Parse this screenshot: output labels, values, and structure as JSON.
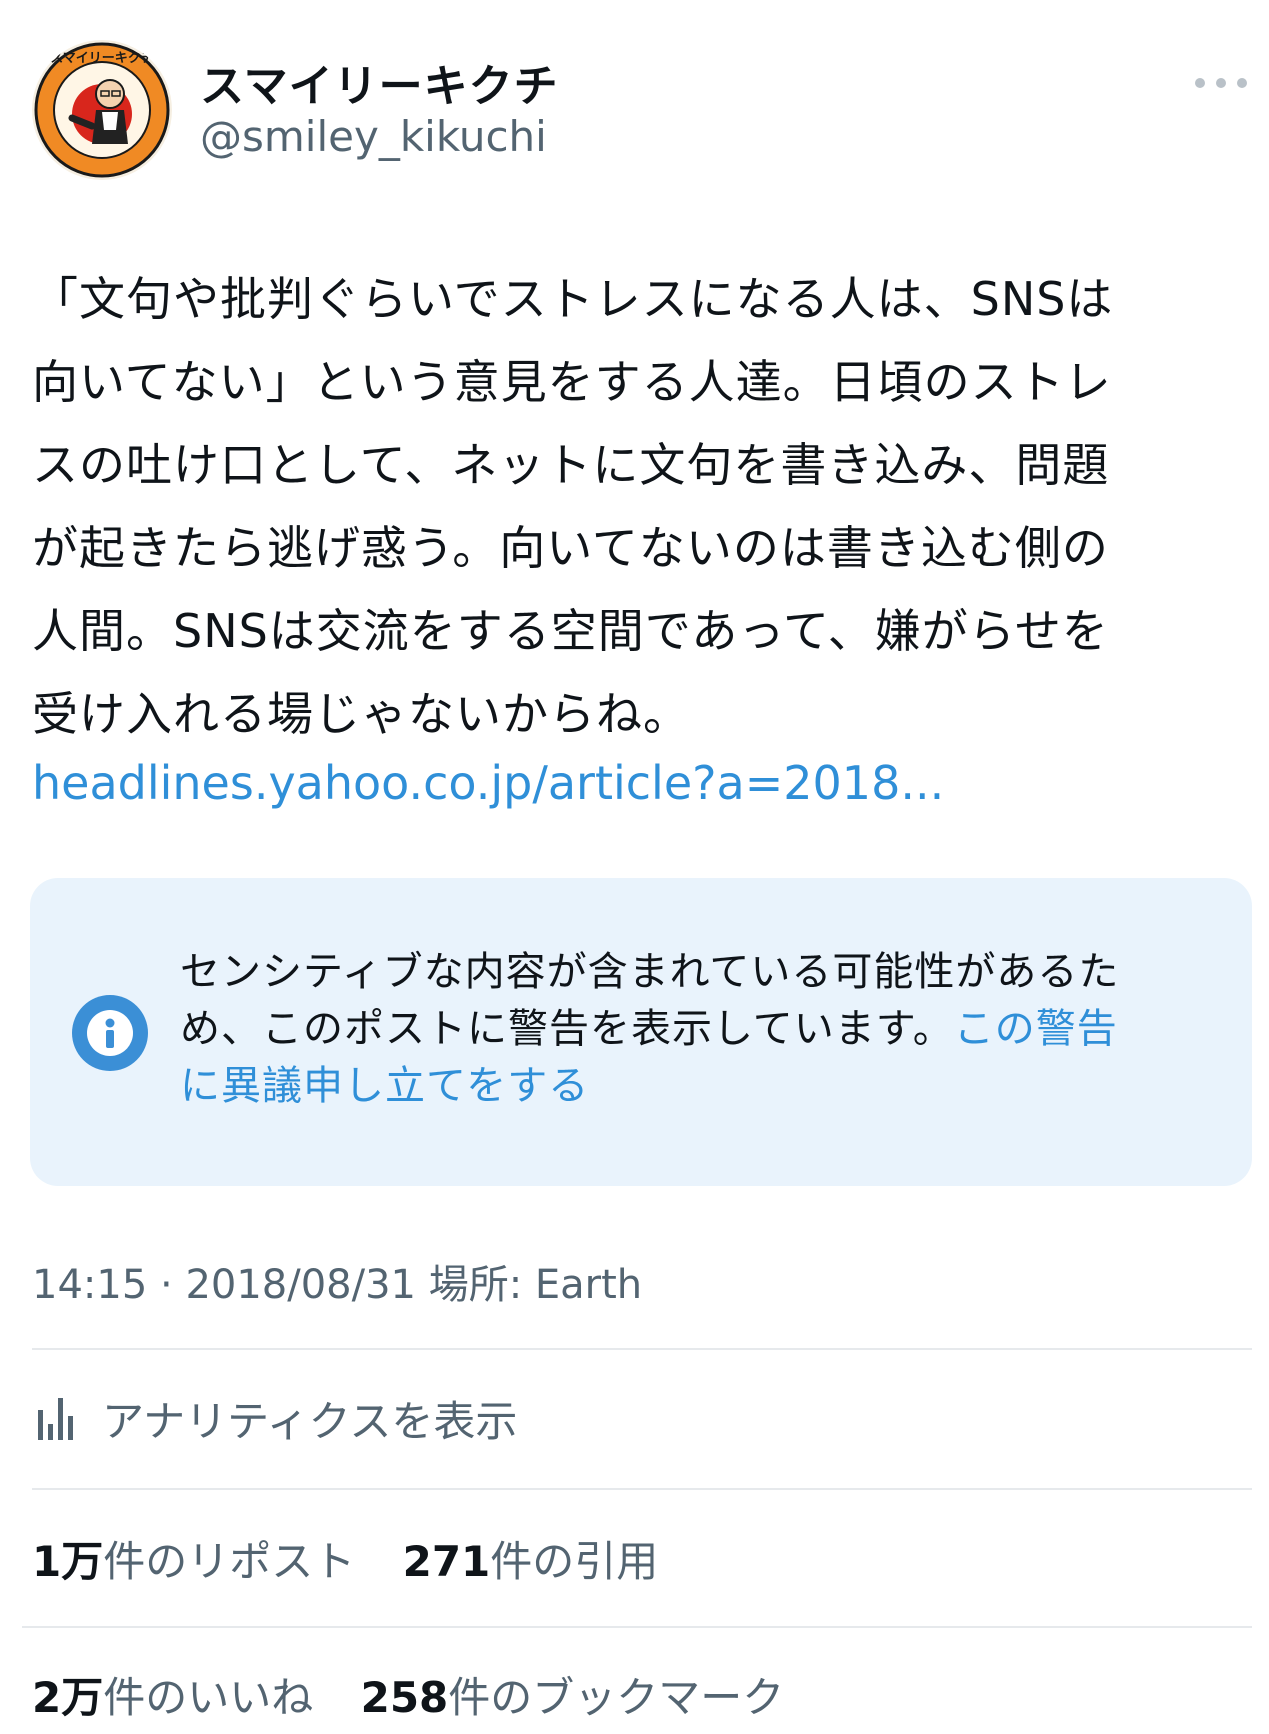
{
  "author": {
    "display_name": "スマイリーキクチ",
    "handle": "@smiley_kikuchi",
    "avatar_icon": "avatar-image",
    "avatar_ring_text": "スマイリーキクチ"
  },
  "tweet": {
    "text_lines": [
      "「文句や批判ぐらいでストレスになる人は、SNSは",
      "向いてない」という意見をする人達。日頃のストレ",
      "スの吐け口として、ネットに文句を書き込み、問題",
      "が起きたら逃げ惑う。向いてないのは書き込む側の",
      "人間。SNSは交流をする空間であって、嫌がらせを",
      "受け入れる場じゃないからね。"
    ],
    "link": "headlines.yahoo.co.jp/article?a=2018..."
  },
  "notice": {
    "icon": "info-icon",
    "line1": "センシティブな内容が含まれている可能性があるた",
    "line2": "め、このポストに警告を表示しています。",
    "appeal_part1": "この警告",
    "appeal_part2": "に異議申し立てをする"
  },
  "meta": {
    "time": "14:15",
    "separator": " · ",
    "date": "2018/08/31",
    "location_label": "場所: Earth"
  },
  "analytics": {
    "icon": "bar-chart-icon",
    "label": "アナリティクスを表示"
  },
  "stats": {
    "reposts_count": "1万",
    "reposts_label": "件のリポスト",
    "quotes_count": "271",
    "quotes_label": "件の引用",
    "likes_count": "2万",
    "likes_label": "件のいいね",
    "bookmarks_count": "258",
    "bookmarks_label": "件のブックマーク"
  },
  "colors": {
    "link": "#2f8fd8",
    "notice_bg": "#e9f3fc",
    "info_icon": "#3b8fd6",
    "secondary_text": "#536471",
    "avatar_orange": "#f08a24",
    "avatar_red": "#d8261c"
  }
}
